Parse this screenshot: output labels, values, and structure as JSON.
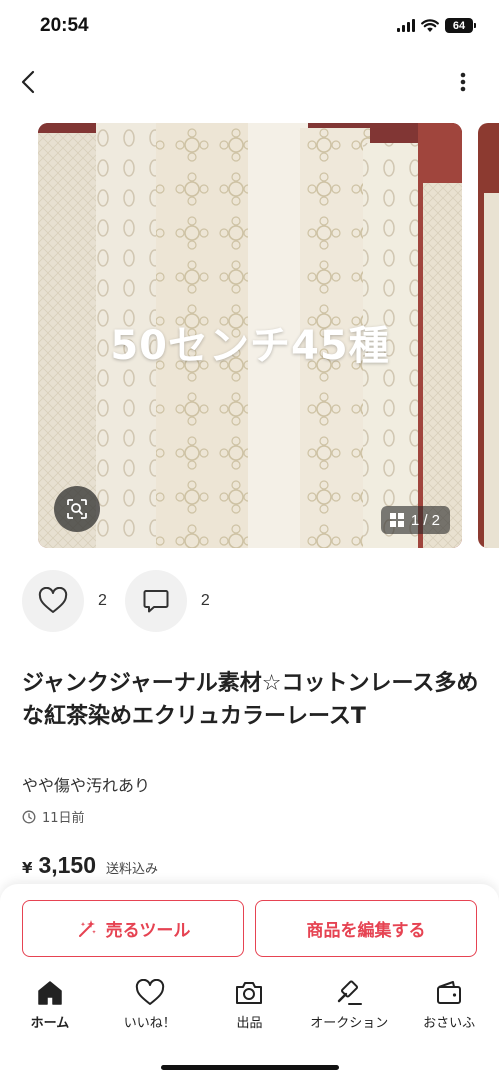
{
  "status": {
    "time": "20:54",
    "battery": "64"
  },
  "gallery": {
    "overlay_text": "50センチ45種",
    "page_counter": "1 / 2"
  },
  "actions": {
    "likes": "2",
    "comments": "2"
  },
  "item": {
    "title": "ジャンクジャーナル素材☆コットンレース多めな紅茶染めエクリュカラーレースT",
    "condition": "やや傷や汚れあり",
    "posted": "11日前",
    "currency": "¥",
    "price": "3,150",
    "shipping": "送料込み"
  },
  "buttons": {
    "sell_tool": "売るツール",
    "edit_item": "商品を編集する"
  },
  "tabs": [
    {
      "label": "ホーム",
      "icon": "home-icon",
      "active": true
    },
    {
      "label": "いいね！",
      "icon": "heart-icon",
      "active": false
    },
    {
      "label": "出品",
      "icon": "camera-icon",
      "active": false
    },
    {
      "label": "オークション",
      "icon": "gavel-icon",
      "active": false
    },
    {
      "label": "おさいふ",
      "icon": "wallet-icon",
      "active": false
    }
  ],
  "colors": {
    "accent": "#e64352"
  }
}
